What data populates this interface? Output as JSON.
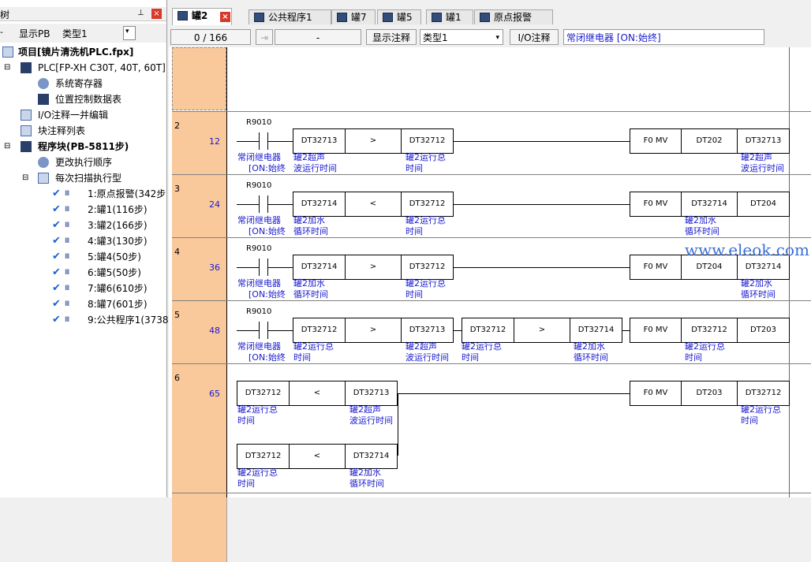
{
  "left_panel": {
    "title": "树",
    "display_pb": "显示PB",
    "type_label": "类型1",
    "tree": [
      "项目[镜片清洗机PLC.fpx]",
      "PLC[FP-XH C30T, 40T, 60T]",
      "系统寄存器",
      "位置控制数据表",
      "I/O注释一并编辑",
      "块注释列表",
      "程序块(PB-5811步)",
      "更改执行顺序",
      "每次扫描执行型",
      "1:原点报警(342步",
      "2:罐1(116步)",
      "3:罐2(166步)",
      "4:罐3(130步)",
      "5:罐4(50步)",
      "6:罐5(50步)",
      "7:罐6(610步)",
      "8:罐7(601步)",
      "9:公共程序1(3738"
    ]
  },
  "tabs": [
    "罐2",
    "公共程序1",
    "罐7",
    "罐5",
    "罐1",
    "原点报警"
  ],
  "status": {
    "position": "0 /   166",
    "dash": "-",
    "show_comment": "显示注释",
    "type": "类型1",
    "io_comment": "I/O注释",
    "comment_text": "常闭继电器   [ON:始终]"
  },
  "ladder": {
    "rung_numbers": [
      "2",
      "3",
      "4",
      "5",
      "6"
    ],
    "steps": [
      "12",
      "24",
      "36",
      "48",
      "65"
    ],
    "contact": "R9010",
    "contact_comment1": "常闭继电器",
    "contact_comment2": "[ON:始终",
    "mv": "F0 MV",
    "lt": "<",
    "gt": ">",
    "dt32712": "DT32712",
    "dt32713": "DT32713",
    "dt32714": "DT32714",
    "dt202": "DT202",
    "dt203": "DT203",
    "dt204": "DT204",
    "c_run_a": "罐2运行总",
    "c_run_b": "时间",
    "c_ultra_a": "罐2超声",
    "c_ultra_b": "波运行时间",
    "c_water_a": "罐2加水",
    "c_water_b": "循环时间"
  },
  "watermark": "www.eleok.com"
}
